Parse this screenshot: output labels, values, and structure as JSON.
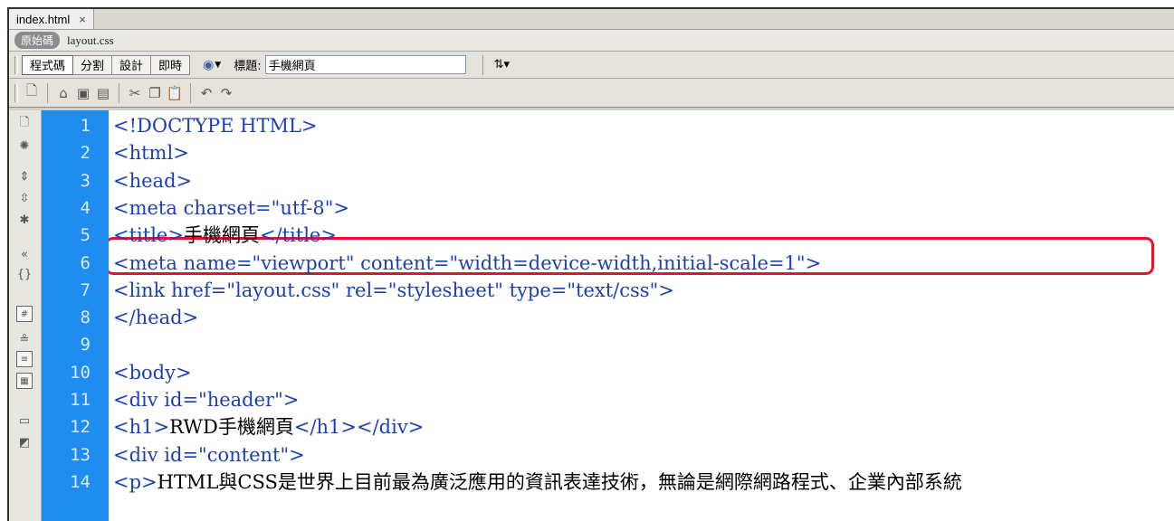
{
  "tab": {
    "filename": "index.html",
    "close_glyph": "×"
  },
  "related": {
    "source_label": "原始碼",
    "file": "layout.css"
  },
  "doc_toolbar": {
    "views": [
      "程式碼",
      "分割",
      "設計",
      "即時"
    ],
    "title_label": "標題:",
    "title_value": "手機網頁"
  },
  "std_toolbar": {
    "icons": [
      "new-document-icon",
      "browse-icon",
      "save-icon",
      "save-all-icon",
      "cut-icon",
      "copy-icon",
      "paste-icon",
      "undo-icon",
      "redo-icon"
    ]
  },
  "coding_toolbar": {
    "icons": [
      "open-documents-icon",
      "show-code-navigator-icon",
      "collapse-full-tag-icon",
      "collapse-selection-icon",
      "expand-all-icon",
      "select-parent-tag-icon",
      "balance-braces-icon",
      "line-numbers-icon",
      "highlight-invalid-code-icon",
      "syntax-coloring-icon",
      "word-wrap-icon",
      "info-icon",
      "apply-comment-icon",
      "remove-comment-icon"
    ]
  },
  "colors": {
    "gutter": "#1f8df0",
    "tag": "#1b3fb4",
    "highlight": "#e8102b"
  },
  "editor": {
    "line_numbers": [
      "1",
      "2",
      "3",
      "4",
      "5",
      "6",
      "7",
      "8",
      "9",
      "10",
      "11",
      "12",
      "13",
      "14"
    ],
    "lines": [
      [
        {
          "t": "<!DOCTYPE HTML>",
          "c": "tag"
        }
      ],
      [
        {
          "t": "<html>",
          "c": "tag"
        }
      ],
      [
        {
          "t": "<head>",
          "c": "tag"
        }
      ],
      [
        {
          "t": "<meta charset=\"utf-8\">",
          "c": "tag"
        }
      ],
      [
        {
          "t": "<title>",
          "c": "tag"
        },
        {
          "t": "手機網頁",
          "c": "txt"
        },
        {
          "t": "</title>",
          "c": "tag"
        }
      ],
      [
        {
          "t": "<meta name=\"viewport\" content=\"width=device-width,initial-scale=1\">",
          "c": "tag"
        }
      ],
      [
        {
          "t": "<link href=\"layout.css\" rel=\"stylesheet\" type=\"text/css\">",
          "c": "tag"
        }
      ],
      [
        {
          "t": "</head>",
          "c": "tag"
        }
      ],
      [],
      [
        {
          "t": "<body>",
          "c": "tag"
        }
      ],
      [
        {
          "t": "<div id=\"header\">",
          "c": "tag"
        }
      ],
      [
        {
          "t": "<h1>",
          "c": "tag"
        },
        {
          "t": "RWD手機網頁",
          "c": "txt"
        },
        {
          "t": "</h1></div>",
          "c": "tag"
        }
      ],
      [
        {
          "t": "<div id=\"content\">",
          "c": "tag"
        }
      ],
      [
        {
          "t": "<p>",
          "c": "tag"
        },
        {
          "t": "HTML與CSS是世界上目前最為廣泛應用的資訊表達技術，無論是網際網路程式、企業內部系統",
          "c": "txt"
        }
      ]
    ]
  }
}
